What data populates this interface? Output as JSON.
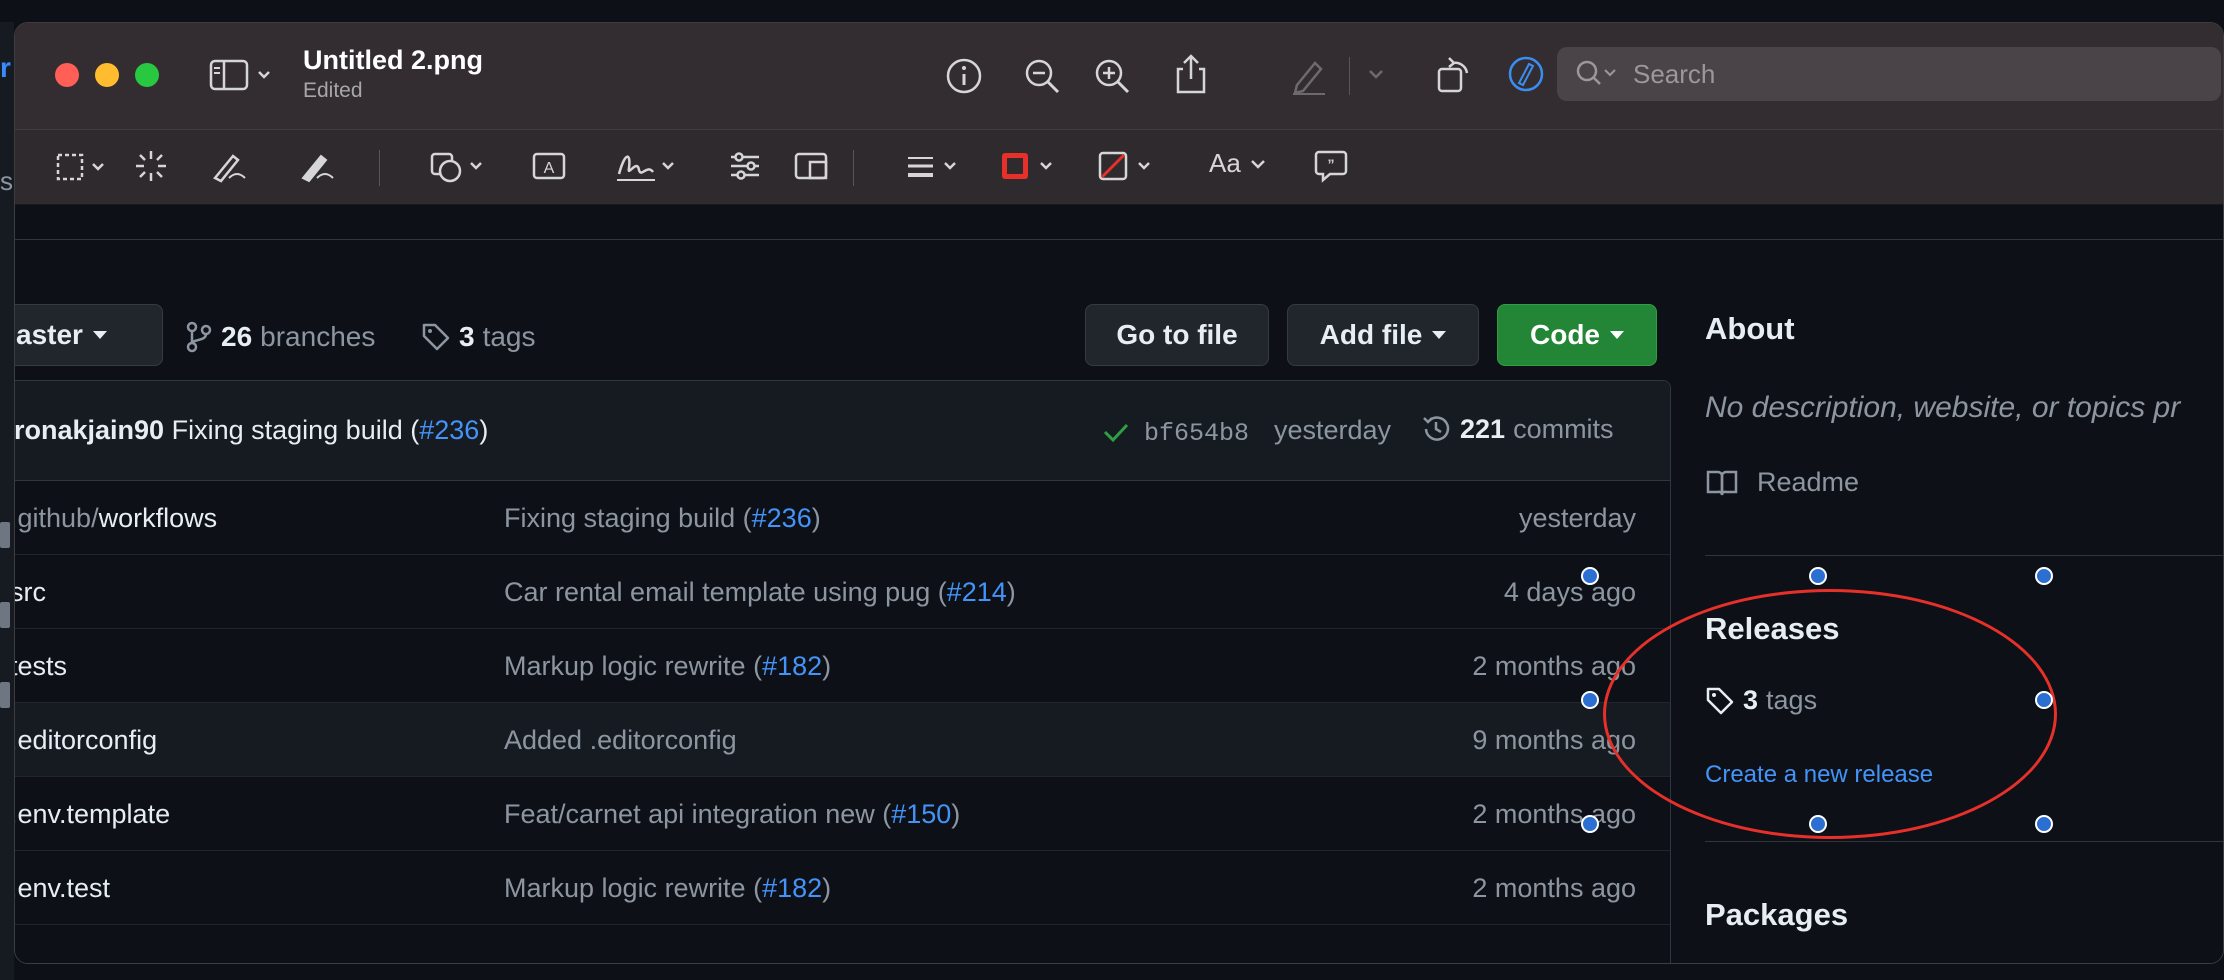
{
  "window": {
    "title": "Untitled 2.png",
    "subtitle": "Edited"
  },
  "search": {
    "placeholder": "Search"
  },
  "toolbar_icons": [
    "sidebar-icon",
    "info-icon",
    "zoom-out-icon",
    "zoom-in-icon",
    "share-icon",
    "markup-pen-icon",
    "rotate-icon",
    "markup-circle-icon",
    "selection-icon",
    "instant-alpha-icon",
    "sketch-icon",
    "draw-icon",
    "shapes-icon",
    "text-icon",
    "sign-icon",
    "adjust-color-icon",
    "adjust-size-icon",
    "shape-style-icon",
    "border-color-icon",
    "fill-color-icon",
    "text-style-icon",
    "speech-bubble-icon"
  ],
  "text_style_label": "Aa",
  "bleed": {
    "char": "r",
    "partial": "s"
  },
  "repo": {
    "branch_label": "aster",
    "branches_count": "26",
    "branches_label": "branches",
    "tags_count": "3",
    "tags_label": "tags",
    "go_to_file": "Go to file",
    "add_file": "Add file",
    "code": "Code"
  },
  "commit": {
    "author": "ronakjain90",
    "message": "Fixing staging build (",
    "pr": "#236",
    "close": ")",
    "hash": "bf654b8",
    "when": "yesterday",
    "commits_count": "221",
    "commits_label": "commits"
  },
  "files": [
    {
      "dim": ".github/",
      "name": "workflows",
      "msg": "Fixing staging build (",
      "pr": "#236",
      "close": ")",
      "age": "yesterday"
    },
    {
      "dim": "",
      "name": "src",
      "msg": "Car rental email template using pug (",
      "pr": "#214",
      "close": ")",
      "age": "4 days ago"
    },
    {
      "dim": "",
      "name": "tests",
      "msg": "Markup logic rewrite (",
      "pr": "#182",
      "close": ")",
      "age": "2 months ago"
    },
    {
      "dim": "",
      "name": ".editorconfig",
      "msg": "Added .editorconfig",
      "pr": "",
      "close": "",
      "age": "9 months ago"
    },
    {
      "dim": "",
      "name": ".env.template",
      "msg": "Feat/carnet api integration new (",
      "pr": "#150",
      "close": ")",
      "age": "2 months ago"
    },
    {
      "dim": "",
      "name": ".env.test",
      "msg": "Markup logic rewrite (",
      "pr": "#182",
      "close": ")",
      "age": "2 months ago"
    }
  ],
  "sidebar": {
    "about_title": "About",
    "about_desc": "No description, website, or topics pr",
    "readme": "Readme",
    "releases_title": "Releases",
    "release_tags_count": "3",
    "release_tags_label": "tags",
    "create_release": "Create a new release",
    "packages_title": "Packages"
  },
  "annotation": {
    "color": "#e8302a",
    "handle_color": "#2a6fd1"
  },
  "colors": {
    "accent_link": "#4493f8",
    "success": "#2ea043",
    "bg": "#0d1117"
  }
}
